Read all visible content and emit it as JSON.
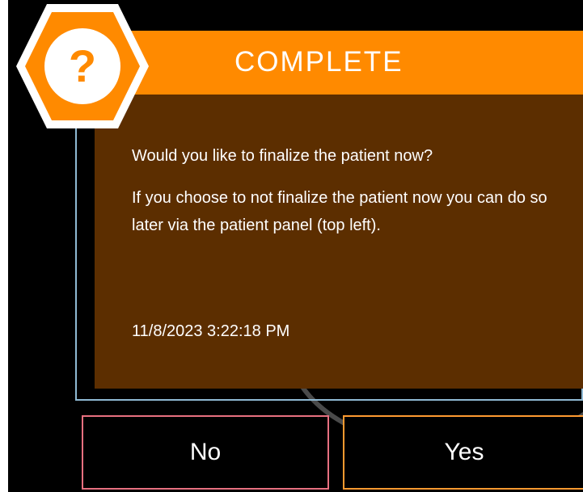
{
  "dialog": {
    "title": "COMPLETE",
    "icon": "question-mark-icon",
    "icon_glyph": "?",
    "message_line1": "Would you like to finalize the patient now?",
    "message_line2": "If you choose to not finalize the patient now you can do so later via the patient panel (top left).",
    "timestamp": "11/8/2023 3:22:18 PM"
  },
  "buttons": {
    "no_label": "No",
    "yes_label": "Yes"
  },
  "colors": {
    "accent_orange": "#ff8a00",
    "dialog_body": "#5c2e00",
    "frame_blue": "#8fb9d3",
    "no_border": "#e87080",
    "yes_border": "#ff9a30"
  }
}
